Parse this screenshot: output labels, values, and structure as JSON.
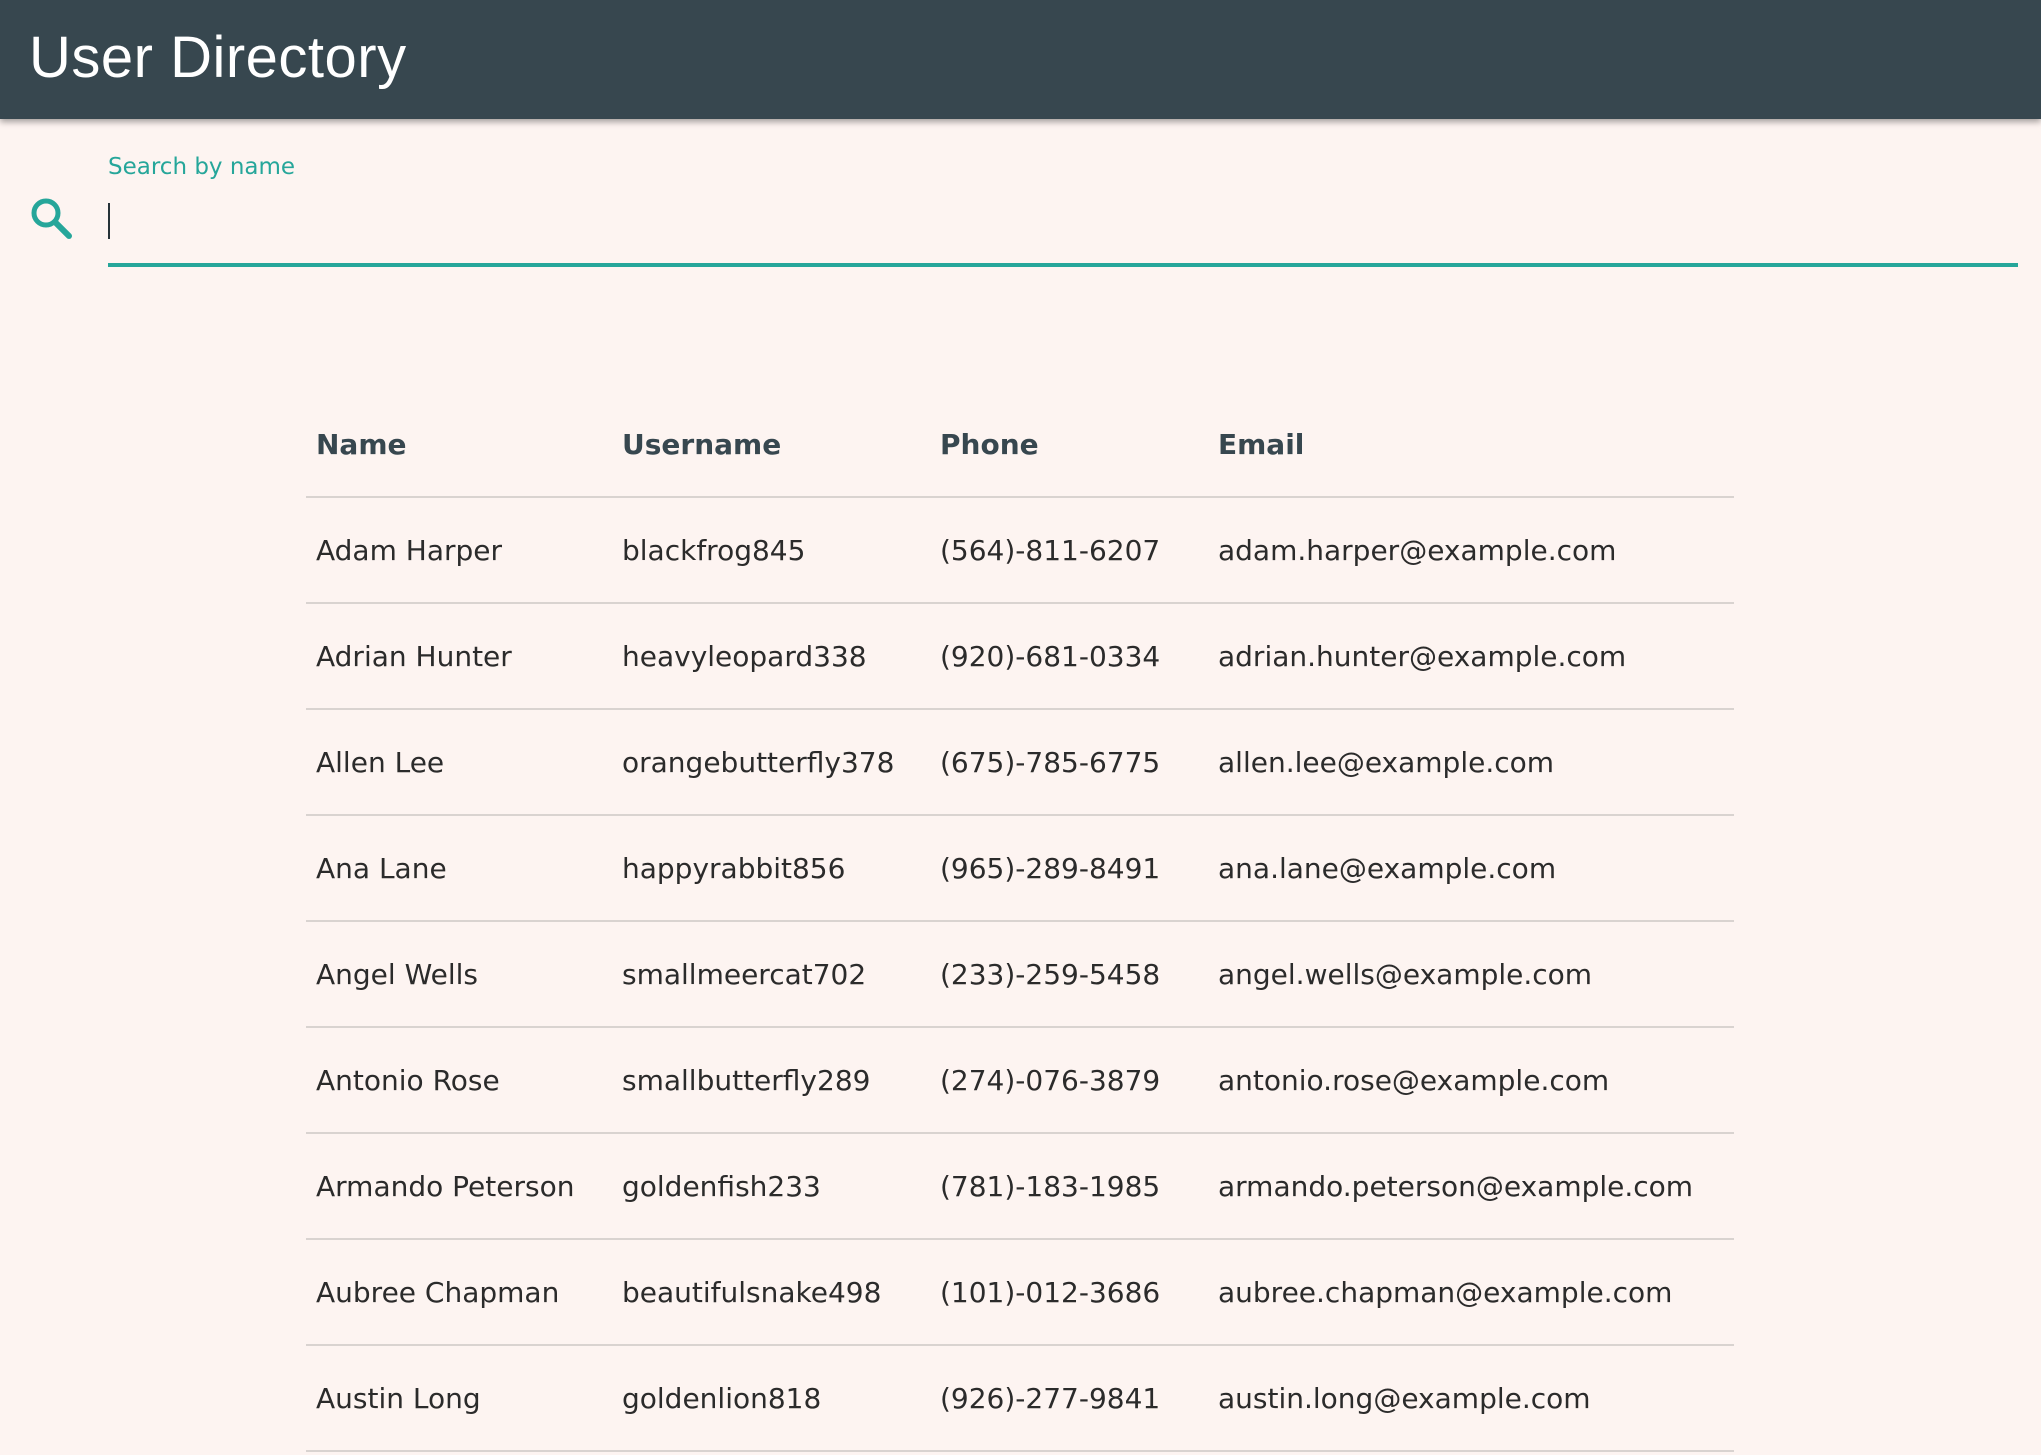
{
  "app": {
    "title": "User Directory",
    "accent": "#26a69a",
    "appbar_color": "#37474f",
    "background": "#fdf4f1"
  },
  "search": {
    "label": "Search by name",
    "value": "",
    "icon": "search-icon"
  },
  "table": {
    "headers": [
      "Name",
      "Username",
      "Phone",
      "Email"
    ],
    "rows": [
      [
        "Adam Harper",
        "blackfrog845",
        "(564)-811-6207",
        "adam.harper@example.com"
      ],
      [
        "Adrian Hunter",
        "heavyleopard338",
        "(920)-681-0334",
        "adrian.hunter@example.com"
      ],
      [
        "Allen Lee",
        "orangebutterfly378",
        "(675)-785-6775",
        "allen.lee@example.com"
      ],
      [
        "Ana Lane",
        "happyrabbit856",
        "(965)-289-8491",
        "ana.lane@example.com"
      ],
      [
        "Angel Wells",
        "smallmeercat702",
        "(233)-259-5458",
        "angel.wells@example.com"
      ],
      [
        "Antonio Rose",
        "smallbutterfly289",
        "(274)-076-3879",
        "antonio.rose@example.com"
      ],
      [
        "Armando Peterson",
        "goldenfish233",
        "(781)-183-1985",
        "armando.peterson@example.com"
      ],
      [
        "Aubree Chapman",
        "beautifulsnake498",
        "(101)-012-3686",
        "aubree.chapman@example.com"
      ],
      [
        "Austin Long",
        "goldenlion818",
        "(926)-277-9841",
        "austin.long@example.com"
      ]
    ]
  }
}
